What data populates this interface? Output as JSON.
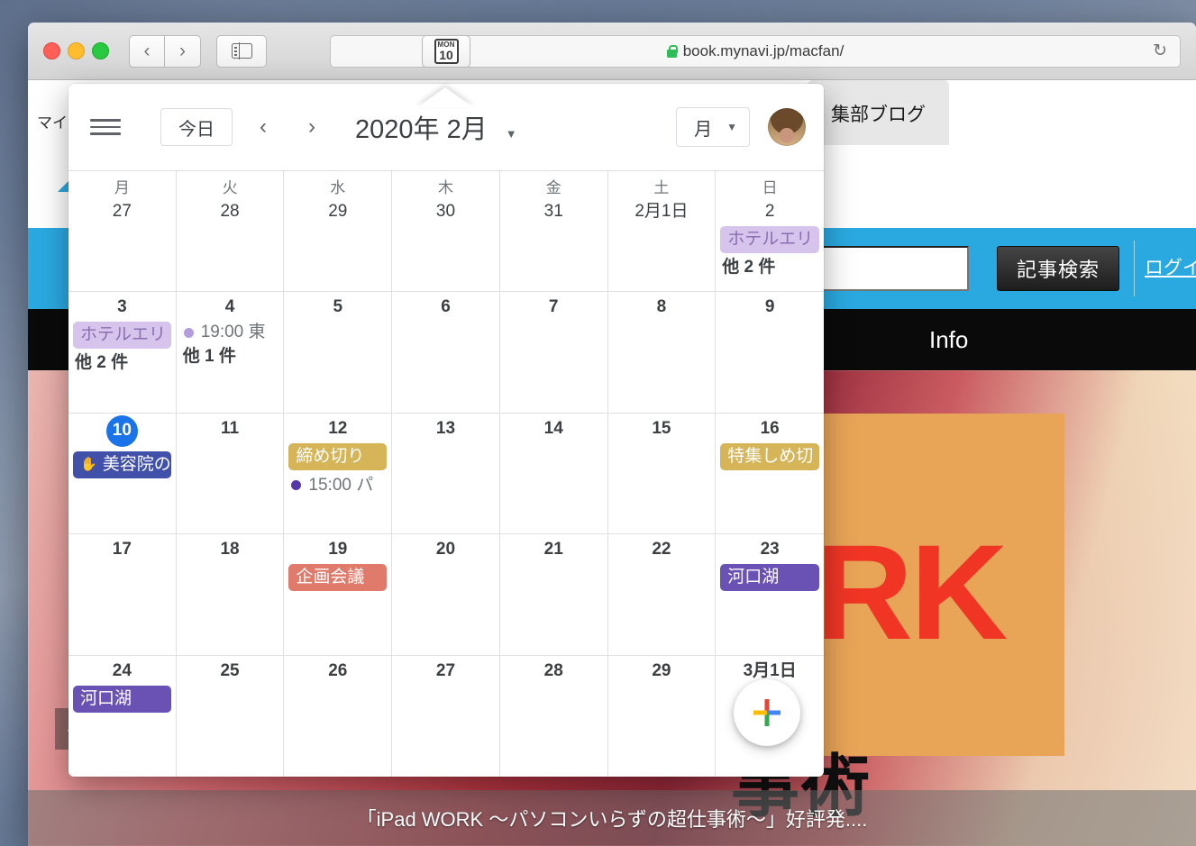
{
  "browser": {
    "url": "book.mynavi.jp/macfan/",
    "lock_icon": "lock-icon",
    "back_label": "‹",
    "forward_label": "›",
    "sidebar_icon": "sidebar-icon",
    "reload_label": "↻",
    "extension_icon": {
      "weekday": "MON",
      "day": "10"
    }
  },
  "page": {
    "top_label": "マイ",
    "tab_label": "集部ブログ",
    "search_button": "記事検索",
    "search_placeholder": "",
    "search_value": "",
    "login_link": "ログイ",
    "nav_info": "Info",
    "banner_work": "ORK",
    "banner_jutsu": "事術",
    "carousel_prev": "‹",
    "caption": "「iPad WORK ～パソコンいらずの超仕事術～」好評発...."
  },
  "calendar": {
    "menu_icon": "hamburger-icon",
    "today_button": "今日",
    "prev_label": "‹",
    "next_label": "›",
    "title": "2020年 2月",
    "title_caret": "▼",
    "view": "月",
    "view_caret": "▼",
    "avatar": "user-avatar",
    "fab_label": "create-event",
    "weekdays": [
      "月",
      "火",
      "水",
      "木",
      "金",
      "土",
      "日"
    ],
    "weeks": [
      [
        {
          "day": "27",
          "events": []
        },
        {
          "day": "28",
          "events": []
        },
        {
          "day": "29",
          "events": []
        },
        {
          "day": "30",
          "events": []
        },
        {
          "day": "31",
          "events": []
        },
        {
          "day": "2月1日",
          "events": []
        },
        {
          "day": "2",
          "events": [
            {
              "kind": "chip",
              "color": "lavender",
              "text": "ホテルエリ"
            },
            {
              "kind": "more",
              "text": "他 2 件"
            }
          ]
        }
      ],
      [
        {
          "day": "3",
          "events": [
            {
              "kind": "chip",
              "color": "lavender",
              "text": "ホテルエリ"
            },
            {
              "kind": "more",
              "text": "他 2 件"
            }
          ]
        },
        {
          "day": "4",
          "events": [
            {
              "kind": "timed",
              "dot": "lav",
              "text": "19:00 東"
            },
            {
              "kind": "more",
              "text": "他 1 件"
            }
          ]
        },
        {
          "day": "5",
          "events": []
        },
        {
          "day": "6",
          "events": []
        },
        {
          "day": "7",
          "events": []
        },
        {
          "day": "8",
          "events": []
        },
        {
          "day": "9",
          "events": []
        }
      ],
      [
        {
          "day": "10",
          "today": true,
          "events": [
            {
              "kind": "chip",
              "color": "indigo",
              "icon": "✋",
              "text": "美容院の"
            }
          ]
        },
        {
          "day": "11",
          "events": []
        },
        {
          "day": "12",
          "events": [
            {
              "kind": "chip",
              "color": "gold",
              "text": "締め切り"
            },
            {
              "kind": "timed",
              "dot": "deep",
              "text": "15:00 パ"
            }
          ]
        },
        {
          "day": "13",
          "events": []
        },
        {
          "day": "14",
          "events": []
        },
        {
          "day": "15",
          "events": []
        },
        {
          "day": "16",
          "events": [
            {
              "kind": "chip",
              "color": "gold",
              "text": "特集しめ切"
            }
          ]
        }
      ],
      [
        {
          "day": "17",
          "events": []
        },
        {
          "day": "18",
          "events": []
        },
        {
          "day": "19",
          "events": [
            {
              "kind": "chip",
              "color": "salmon",
              "text": "企画会議"
            }
          ]
        },
        {
          "day": "20",
          "events": []
        },
        {
          "day": "21",
          "events": []
        },
        {
          "day": "22",
          "events": []
        },
        {
          "day": "23",
          "events": [
            {
              "kind": "chip",
              "color": "purple",
              "text": "河口湖"
            }
          ]
        }
      ],
      [
        {
          "day": "24",
          "events": [
            {
              "kind": "chip",
              "color": "purple",
              "text": "河口湖"
            }
          ]
        },
        {
          "day": "25",
          "events": []
        },
        {
          "day": "26",
          "events": []
        },
        {
          "day": "27",
          "events": []
        },
        {
          "day": "28",
          "events": []
        },
        {
          "day": "29",
          "events": []
        },
        {
          "day": "3月1日",
          "events": []
        }
      ]
    ]
  },
  "colors": {
    "accent_blue": "#1a73e8",
    "site_blue": "#2aa9e0",
    "chip_lavender": "#d7c4ec",
    "chip_gold": "#d6b458",
    "chip_salmon": "#e07a6b",
    "chip_purple": "#6a52b5",
    "chip_indigo": "#4150a8",
    "banner_orange": "#e8a457",
    "banner_red": "#f03525"
  }
}
